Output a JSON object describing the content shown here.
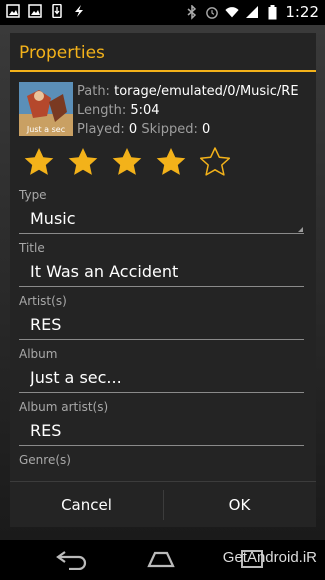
{
  "status_bar": {
    "time": "1:22",
    "left_icons": [
      "image-icon",
      "image-icon",
      "phone-download-icon",
      "bolt-icon"
    ],
    "right_icons": [
      "bluetooth-icon",
      "alarm-icon",
      "wifi-icon",
      "signal-icon",
      "battery-icon"
    ]
  },
  "dialog": {
    "title": "Properties",
    "accent_color": "#f3b21a",
    "info": {
      "path_label": "Path:",
      "path_value": "torage/emulated/0/Music/RE",
      "length_label": "Length:",
      "length_value": "5:04",
      "played_label": "Played:",
      "played_value": "0",
      "skipped_label": "Skipped:",
      "skipped_value": "0",
      "artwork_text": "Just a sec"
    },
    "rating": {
      "filled": 4,
      "total": 5
    },
    "fields": [
      {
        "label": "Type",
        "value": "Music"
      },
      {
        "label": "Title",
        "value": "It Was an Accident"
      },
      {
        "label": "Artist(s)",
        "value": "RES"
      },
      {
        "label": "Album",
        "value": "Just a sec..."
      },
      {
        "label": "Album artist(s)",
        "value": "RES"
      },
      {
        "label": "Genre(s)",
        "value": ""
      }
    ],
    "buttons": {
      "cancel": "Cancel",
      "ok": "OK"
    }
  },
  "nav_bar": {
    "icons": [
      "back-icon",
      "home-icon",
      "recents-icon"
    ],
    "watermark": "GetAndroid.iR"
  }
}
